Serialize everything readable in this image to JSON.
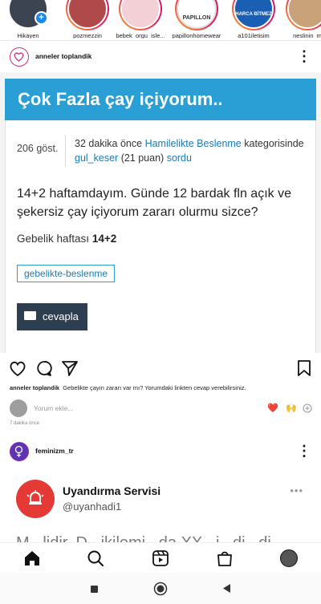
{
  "stories": [
    {
      "label": "Hikayen",
      "own": true,
      "color": "#3b4450"
    },
    {
      "label": "pozmezzin",
      "own": false,
      "color": "#b04a4a"
    },
    {
      "label": "bebek_orgu_isle...",
      "own": false,
      "color": "#f3d0d6"
    },
    {
      "label": "papillonhomewear",
      "own": false,
      "color": "#ffffff",
      "logo_text": "PAPILLON"
    },
    {
      "label": "a101iletisim",
      "own": false,
      "color": "#1a5fb4",
      "logo_text": "HARCA BİTMEZ"
    },
    {
      "label": "neslinin_m",
      "own": false,
      "color": "#c9a27a"
    }
  ],
  "post1": {
    "username": "anneler toplandik",
    "question_title": "Çok Fazla çay içiyorum..",
    "views": "206 göst.",
    "meta_prefix": "32 dakika önce",
    "meta_category": "Hamilelikte Beslenme",
    "meta_mid": "kategorisinde",
    "meta_user": "gul_keser",
    "meta_points": "(21 puan)",
    "meta_verb": "sordu",
    "question_text": "14+2 haftamdayım. Günde 12 bardak fln açık ve şekersiz çay içiyorum zararı olurmu sizce?",
    "week_label": "Gebelik haftası",
    "week_value": "14+2",
    "tag": "gebelikte-beslenme",
    "reply_button": "cevapla",
    "caption_user": "anneler toplandik",
    "caption_text": "Gebelikte çayın zararı var mı? Yorumdaki linkten cevap verebilirsiniz.",
    "comment_placeholder": "Yorum ekle...",
    "time_ago": "7 dakika önce",
    "quick_emojis": [
      "❤️",
      "🙌"
    ]
  },
  "post2": {
    "username": "feminizm_tr",
    "tweet_name": "Uyandırma Servisi",
    "tweet_handle": "@uyanhadi1",
    "tweet_text": "M...lidir. D...ikilemi...da XX...i...di...di..."
  },
  "colors": {
    "accent": "#2a9fd6",
    "link": "#1d7bb5",
    "reply_bg": "#2c3e50",
    "brand_ring": "#c13584"
  },
  "icons": {
    "actions": [
      "heart-icon",
      "comment-icon",
      "share-icon",
      "bookmark-icon"
    ],
    "nav": [
      "home-icon",
      "search-icon",
      "reels-icon",
      "shop-icon",
      "profile-avatar"
    ],
    "system": [
      "recents-icon",
      "home-circle-icon",
      "back-icon"
    ]
  }
}
